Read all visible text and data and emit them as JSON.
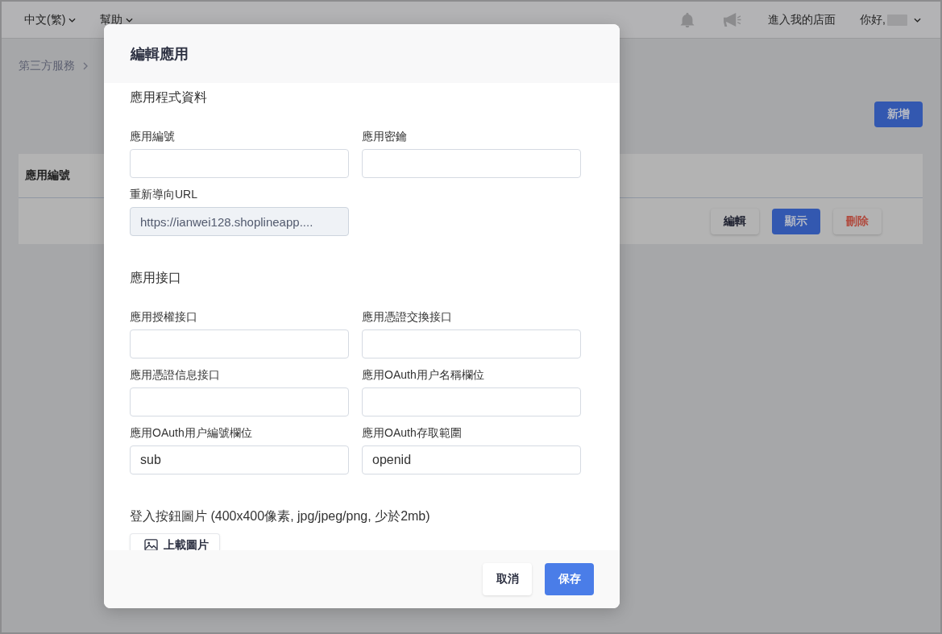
{
  "top_nav": {
    "menus": [
      {
        "label": "中文(繁)"
      },
      {
        "label": "幫助"
      }
    ],
    "store_link": "進入我的店面",
    "greeting": "你好,"
  },
  "breadcrumb": [
    "第三方服務"
  ],
  "add_button": "新增",
  "table": {
    "columns": [
      "應用編號"
    ],
    "rows": [
      {
        "actions": [
          {
            "label": "編輯",
            "kind": "default"
          },
          {
            "label": "顯示",
            "kind": "primary"
          },
          {
            "label": "刪除",
            "kind": "danger"
          }
        ]
      }
    ]
  },
  "modal": {
    "title": "編輯應用",
    "sections": [
      {
        "title": "應用程式資料",
        "fields": [
          {
            "label": "應用編號",
            "disabled": false
          },
          {
            "label": "應用密鑰",
            "disabled": false
          },
          {
            "label": "重新導向URL",
            "value": "https://ianwei128.shoplineapp....",
            "disabled": true
          }
        ]
      },
      {
        "title": "應用接口",
        "fields": [
          {
            "label": "應用授權接口",
            "disabled": false
          },
          {
            "label": "應用憑證交換接口",
            "disabled": false
          },
          {
            "label": "應用憑證信息接口",
            "disabled": false
          },
          {
            "label": "應用OAuth用户名稱欄位",
            "disabled": false
          },
          {
            "label": "應用OAuth用户編號欄位",
            "value": "sub",
            "disabled": false
          },
          {
            "label": "應用OAuth存取範圍",
            "value": "openid",
            "disabled": false
          }
        ]
      }
    ],
    "upload": {
      "label": "登入按鈕圖片 (400x400像素, jpg/jpeg/png, 少於2mb)",
      "button": "上載圖片"
    },
    "buttons": [
      {
        "label": "取消",
        "kind": "default"
      },
      {
        "label": "保存",
        "kind": "primary"
      }
    ]
  }
}
